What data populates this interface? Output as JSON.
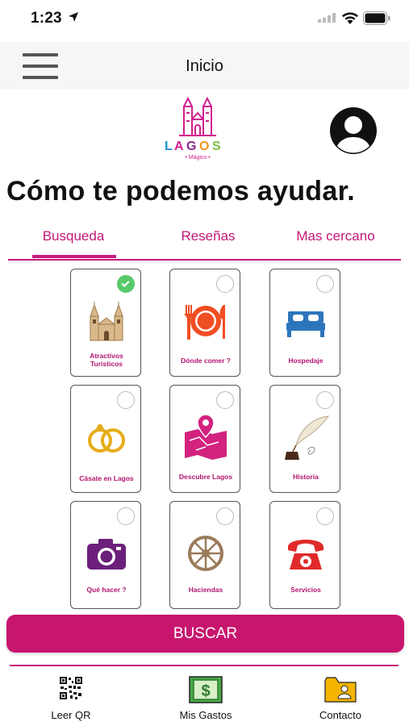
{
  "status_bar": {
    "time": "1:23"
  },
  "nav": {
    "title": "Inicio"
  },
  "logo": {
    "text": "LAGOS",
    "subtext": "Mágico"
  },
  "page": {
    "title": "Cómo te podemos ayudar."
  },
  "tabs": [
    {
      "label": "Busqueda",
      "active": true
    },
    {
      "label": "Reseñas",
      "active": false
    },
    {
      "label": "Mas cercano",
      "active": false
    }
  ],
  "cards": [
    {
      "label_line1": "Atractivos",
      "label_line2": "Turisticos",
      "icon": "church-icon",
      "selected": true
    },
    {
      "label_line1": "Dónde comer ?",
      "label_line2": "",
      "icon": "plate-cutlery-icon",
      "selected": false
    },
    {
      "label_line1": "Hospedaje",
      "label_line2": "",
      "icon": "bed-icon",
      "selected": false
    },
    {
      "label_line1": "Cásate en Lagos",
      "label_line2": "",
      "icon": "rings-icon",
      "selected": false
    },
    {
      "label_line1": "Descubre Lagos",
      "label_line2": "",
      "icon": "map-pin-icon",
      "selected": false
    },
    {
      "label_line1": "Historia",
      "label_line2": "",
      "icon": "quill-ink-icon",
      "selected": false
    },
    {
      "label_line1": "Qué hacer ?",
      "label_line2": "",
      "icon": "camera-icon",
      "selected": false
    },
    {
      "label_line1": "Haciendas",
      "label_line2": "",
      "icon": "wagon-wheel-icon",
      "selected": false
    },
    {
      "label_line1": "Servicios",
      "label_line2": "",
      "icon": "telephone-icon",
      "selected": false
    }
  ],
  "buscar": {
    "label": "BUSCAR"
  },
  "tabbar": [
    {
      "label": "Leer QR",
      "icon": "qr-code-icon"
    },
    {
      "label": "Mis Gastos",
      "icon": "money-icon"
    },
    {
      "label": "Contacto",
      "icon": "contact-folder-icon"
    }
  ],
  "colors": {
    "accent": "#c41a7a",
    "check": "#58c96b"
  }
}
